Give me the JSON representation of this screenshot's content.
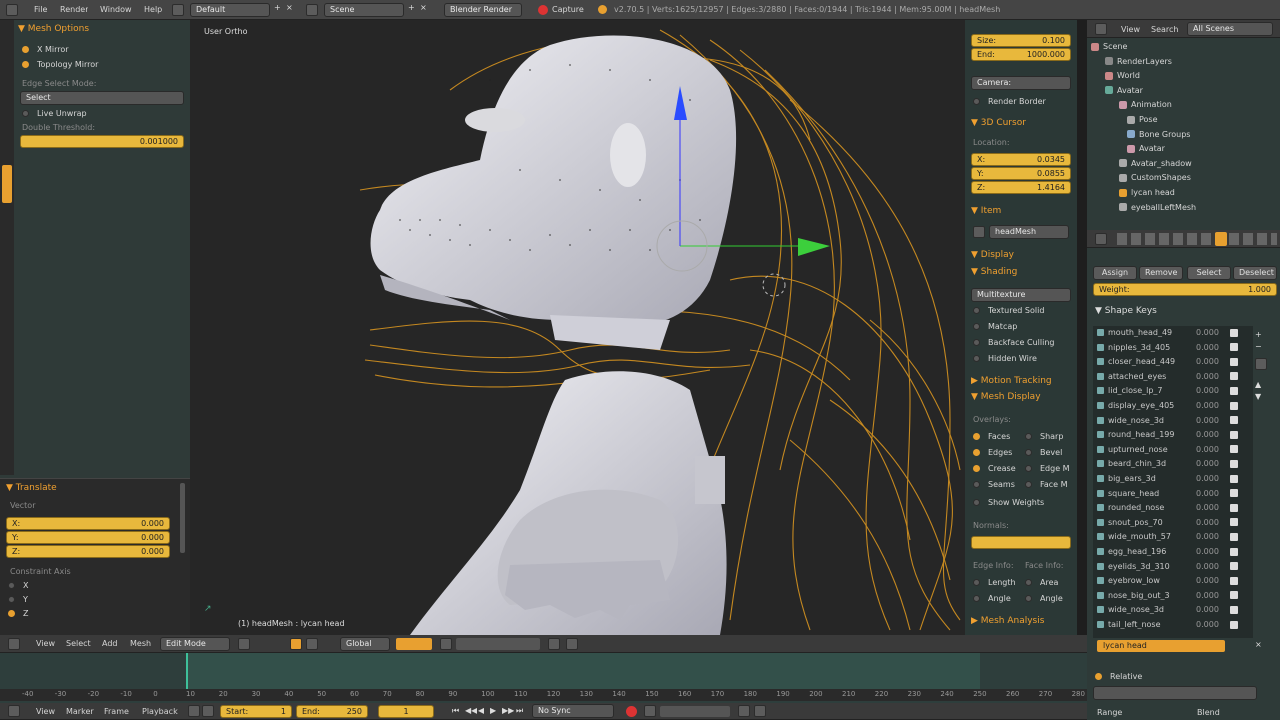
{
  "top_menu": {
    "file": "File",
    "render": "Render",
    "window": "Window",
    "help": "Help",
    "screen_layout": "Default",
    "scene": "Scene",
    "engine": "Blender Render",
    "capture": "Capture",
    "info": "v2.70.5 | Verts:1625/12957 | Edges:3/2880 | Faces:0/1944 | Tris:1944 | Mem:95.00M | headMesh"
  },
  "left_panel": {
    "mesh_options": "Mesh Options",
    "x_mirror": "X Mirror",
    "topology_mirror": "Topology Mirror",
    "edge_select_mode": "Edge Select Mode:",
    "select": "Select",
    "live_unwrap": "Live Unwrap",
    "double_threshold": "Double Threshold:",
    "double_value": "0.001000",
    "translate": "Translate",
    "vector": "Vector",
    "x_label": "X:",
    "x_value": "0.000",
    "y_label": "Y:",
    "y_value": "0.000",
    "z_label": "Z:",
    "z_value": "0.000",
    "constraint_axis": "Constraint Axis",
    "ax_x": "X",
    "ax_y": "Y",
    "ax_z": "Z"
  },
  "viewport": {
    "view_name": "User Ortho",
    "object_label": "(1) headMesh : lycan head"
  },
  "properties_n": {
    "size_label": "Size:",
    "size_value": "0.100",
    "end_label": "End:",
    "end_value": "1000.000",
    "camera": "Camera:",
    "render_border": "Render Border",
    "cursor_3d": "3D Cursor",
    "location": "Location:",
    "cx_label": "X:",
    "cx_value": "0.0345",
    "cy_label": "Y:",
    "cy_value": "0.0855",
    "cz_label": "Z:",
    "cz_value": "1.4164",
    "item": "Item",
    "item_name": "headMesh",
    "display": "Display",
    "shading": "Shading",
    "shading_mode": "Multitexture",
    "textured_solid": "Textured Solid",
    "matcap": "Matcap",
    "backface_culling": "Backface Culling",
    "hidden_wire": "Hidden Wire",
    "motion_tracking": "Motion Tracking",
    "mesh_display": "Mesh Display",
    "overlays": "Overlays:",
    "faces": "Faces",
    "sharp": "Sharp",
    "edges": "Edges",
    "bevel": "Bevel",
    "crease": "Crease",
    "edge_m": "Edge M",
    "seams": "Seams",
    "face_m": "Face M",
    "show_weights": "Show Weights",
    "normals": "Normals:",
    "edge_info": "Edge Info:",
    "face_info": "Face Info:",
    "length": "Length",
    "area": "Area",
    "angle": "Angle",
    "angle2": "Angle",
    "mesh_analysis": "Mesh Analysis"
  },
  "outliner": {
    "view": "View",
    "search": "Search",
    "filter": "All Scenes",
    "items": [
      "Scene",
      "RenderLayers",
      "World",
      "Avatar",
      "Animation",
      "Pose",
      "Bone Groups",
      "Avatar",
      "Avatar_shadow",
      "CustomShapes",
      "lycan head",
      "eyeballLeftMesh"
    ]
  },
  "props_editor": {
    "assign": "Assign",
    "remove": "Remove",
    "select": "Select",
    "deselect": "Deselect",
    "weight_label": "Weight:",
    "weight_value": "1.000",
    "shape_keys": "Shape Keys",
    "keys": [
      {
        "name": "mouth_head_49",
        "v": "0.000"
      },
      {
        "name": "nipples_3d_405",
        "v": "0.000"
      },
      {
        "name": "closer_head_449",
        "v": "0.000"
      },
      {
        "name": "attached_eyes",
        "v": "0.000"
      },
      {
        "name": "lid_close_lp_7",
        "v": "0.000"
      },
      {
        "name": "display_eye_405",
        "v": "0.000"
      },
      {
        "name": "wide_nose_3d",
        "v": "0.000"
      },
      {
        "name": "round_head_199",
        "v": "0.000"
      },
      {
        "name": "upturned_nose",
        "v": "0.000"
      },
      {
        "name": "beard_chin_3d",
        "v": "0.000"
      },
      {
        "name": "big_ears_3d",
        "v": "0.000"
      },
      {
        "name": "square_head",
        "v": "0.000"
      },
      {
        "name": "rounded_nose",
        "v": "0.000"
      },
      {
        "name": "snout_pos_70",
        "v": "0.000"
      },
      {
        "name": "wide_mouth_57",
        "v": "0.000"
      },
      {
        "name": "egg_head_196",
        "v": "0.000"
      },
      {
        "name": "eyelids_3d_310",
        "v": "0.000"
      },
      {
        "name": "eyebrow_low",
        "v": "0.000"
      },
      {
        "name": "nose_big_out_3",
        "v": "0.000"
      },
      {
        "name": "wide_nose_3d",
        "v": "0.000"
      },
      {
        "name": "tail_left_nose",
        "v": "0.000"
      }
    ],
    "active_key": "lycan head",
    "relative": "Relative",
    "range": "Range",
    "blend": "Blend"
  },
  "view_header": {
    "view": "View",
    "select": "Select",
    "add": "Add",
    "mesh": "Mesh",
    "mode": "Edit Mode",
    "pivot": "Global"
  },
  "timeline": {
    "ticks": [
      "-40",
      "-30",
      "-20",
      "-10",
      "0",
      "10",
      "20",
      "30",
      "40",
      "50",
      "60",
      "70",
      "80",
      "90",
      "100",
      "110",
      "120",
      "130",
      "140",
      "150",
      "160",
      "170",
      "180",
      "190",
      "200",
      "210",
      "220",
      "230",
      "240",
      "250",
      "260",
      "270",
      "280"
    ],
    "view": "View",
    "marker": "Marker",
    "frame": "Frame",
    "playback": "Playback",
    "start_label": "Start:",
    "start_value": "1",
    "end_label": "End:",
    "end_value": "250",
    "current": "1",
    "sync": "No Sync"
  },
  "colors": {
    "accent": "#e8a030",
    "bg": "#1e1e1e"
  }
}
